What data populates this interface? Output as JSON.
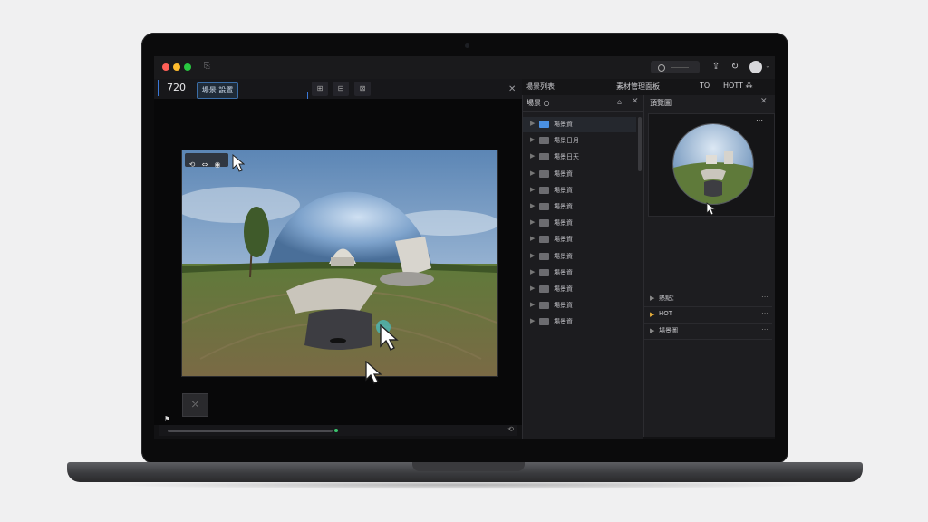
{
  "window": {
    "menu_glyph": "⎘",
    "search_icon": "search-icon",
    "avatar_icon": "avatar",
    "chevron": "⌄"
  },
  "viewer": {
    "resolution_label": "720",
    "mode_button": "場景 設置",
    "tools": [
      "⊞",
      "⊟",
      "⊠"
    ],
    "close": "✕",
    "toolbar_icons": [
      "⟲",
      "⇔",
      "◉"
    ],
    "mini_thumb_label": "⤫",
    "flag": "⚑",
    "timeline_end": "⟲"
  },
  "tabs": {
    "left": "場景列表",
    "middle": "素材管理面板",
    "right_a": "TO",
    "right_b": "HOTT ⁂"
  },
  "scene_panel": {
    "title": "場景 ○",
    "items": [
      {
        "label": "場景資",
        "selected": true
      },
      {
        "label": "場景日月",
        "selected": false
      },
      {
        "label": "場景日天",
        "selected": false
      },
      {
        "label": "場景資",
        "selected": false
      },
      {
        "label": "場景資",
        "selected": false
      },
      {
        "label": "場景資",
        "selected": false
      },
      {
        "label": "場景資",
        "selected": false
      },
      {
        "label": "場景資",
        "selected": false
      },
      {
        "label": "場景資",
        "selected": false
      },
      {
        "label": "場景資",
        "selected": false
      },
      {
        "label": "場景資",
        "selected": false
      },
      {
        "label": "場景資",
        "selected": false
      },
      {
        "label": "場景資",
        "selected": false
      }
    ]
  },
  "props_panel": {
    "title": "預覽圖",
    "rows": [
      {
        "label": "熱點：",
        "active": false
      },
      {
        "label": "HOT",
        "active": true
      },
      {
        "label": "場景圖",
        "active": false
      }
    ],
    "more": "⋯"
  },
  "colors": {
    "accent": "#3a78d8",
    "selection": "#4a90e2",
    "hot": "#e0a93a"
  }
}
